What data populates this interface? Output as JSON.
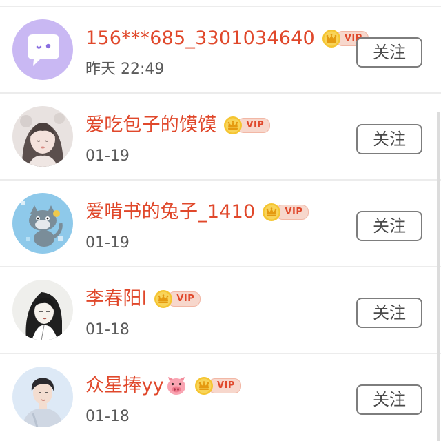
{
  "follow_list": {
    "items": [
      {
        "name": "156***685_3301034640",
        "time": "昨天 22:49",
        "vip_label": "VIP",
        "button_label": "关注",
        "avatar": "default-chat-bubble-avatar",
        "emoji": null
      },
      {
        "name": "爱吃包子的馍馍",
        "time": "01-19",
        "vip_label": "VIP",
        "button_label": "关注",
        "avatar": "illustrated-girl-avatar",
        "emoji": null
      },
      {
        "name": "爱啃书的兔子_1410",
        "time": "01-19",
        "vip_label": "VIP",
        "button_label": "关注",
        "avatar": "cartoon-cat-avatar",
        "emoji": null
      },
      {
        "name": "李春阳l",
        "time": "01-18",
        "vip_label": "VIP",
        "button_label": "关注",
        "avatar": "ink-drawing-avatar",
        "emoji": null
      },
      {
        "name": "众星捧yy",
        "time": "01-18",
        "vip_label": "VIP",
        "button_label": "关注",
        "avatar": "young-man-photo-avatar",
        "emoji": "pig-face-icon"
      }
    ]
  },
  "colors": {
    "name": "#e0482b",
    "time": "#5a5a5a",
    "button_border": "#7d7d7d",
    "divider": "#ececec",
    "vip_gold": "#f2b51c"
  }
}
